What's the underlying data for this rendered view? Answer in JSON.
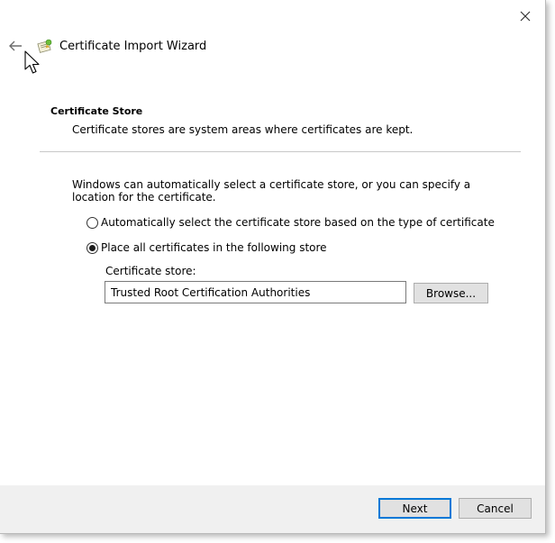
{
  "window": {
    "title": "Certificate Import Wizard",
    "icons": {
      "close": "close-icon",
      "back": "back-arrow-icon",
      "app": "certificate-icon",
      "cursor": "mouse-pointer-icon"
    }
  },
  "page": {
    "section_title": "Certificate Store",
    "section_description": "Certificate stores are system areas where certificates are kept.",
    "intro_text": "Windows can automatically select a certificate store, or you can specify a location for the certificate.",
    "options": [
      {
        "label": "Automatically select the certificate store based on the type of certificate",
        "selected": false
      },
      {
        "label": "Place all certificates in the following store",
        "selected": true
      }
    ],
    "store_label": "Certificate store:",
    "store_value": "Trusted Root Certification Authorities",
    "browse_label": "Browse..."
  },
  "footer": {
    "next_label": "Next",
    "cancel_label": "Cancel"
  },
  "colors": {
    "accent": "#0078d7",
    "footer_background": "#f0f0f0",
    "button_background": "#e1e1e1"
  }
}
